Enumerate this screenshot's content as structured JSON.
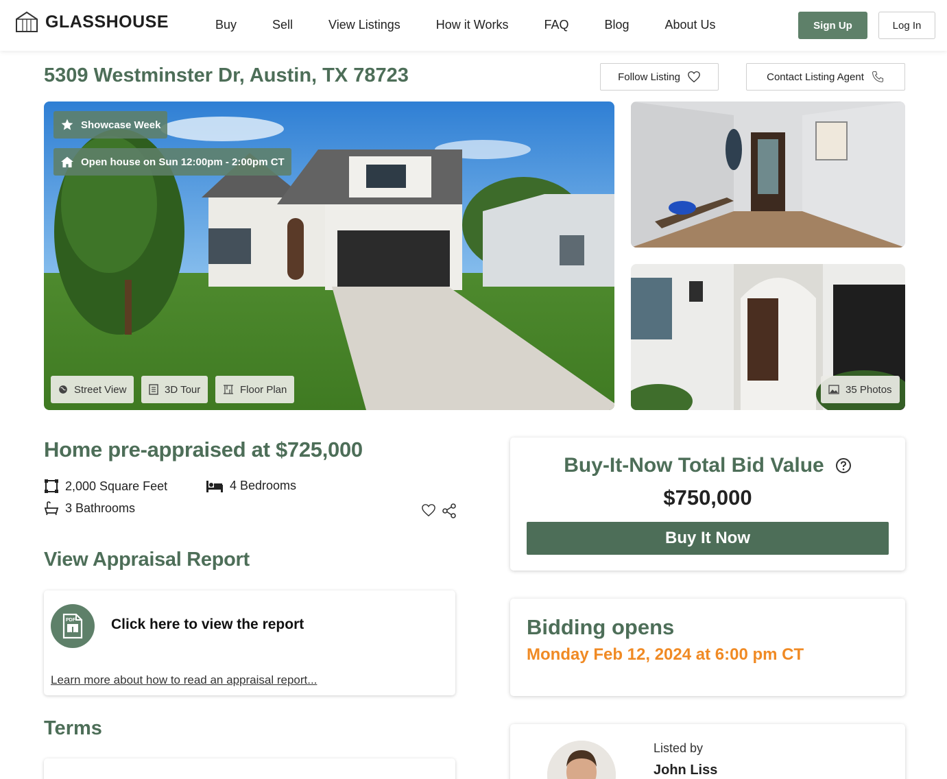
{
  "brand": {
    "name": "GLASSHOUSE",
    "accent": "#4d6e58",
    "button_green": "#5e8069",
    "orange": "#f08a24"
  },
  "nav": {
    "items": [
      {
        "label": "Buy"
      },
      {
        "label": "Sell"
      },
      {
        "label": "View Listings"
      },
      {
        "label": "How it Works"
      },
      {
        "label": "FAQ"
      },
      {
        "label": "Blog"
      },
      {
        "label": "About Us"
      }
    ],
    "signup_label": "Sign Up",
    "login_label": "Log In"
  },
  "listing": {
    "address": "5309 Westminster Dr, Austin, TX 78723",
    "follow_label": "Follow Listing",
    "contact_label": "Contact Listing Agent",
    "badges": {
      "showcase": "Showcase Week",
      "open_house": "Open house on Sun 12:00pm - 2:00pm CT"
    },
    "photo_buttons": {
      "street_view": "Street View",
      "tour_3d": "3D Tour",
      "floor_plan": "Floor Plan",
      "photos": "35 Photos"
    },
    "preappraised": "Home pre-appraised at $725,000",
    "features": {
      "sqft": "2,000 Square Feet",
      "bedrooms": "4 Bedrooms",
      "bathrooms": "3 Bathrooms"
    }
  },
  "appraisal": {
    "title": "View Appraisal Report",
    "cta": "Click here to view the report",
    "learn_more": "Learn more about how to read an appraisal report..."
  },
  "terms": {
    "title": "Terms"
  },
  "buy_it_now": {
    "title": "Buy-It-Now Total Bid Value",
    "value": "$750,000",
    "button_label": "Buy It Now"
  },
  "bidding": {
    "title": "Bidding opens",
    "date": "Monday Feb 12, 2024 at 6:00 pm CT"
  },
  "agent": {
    "listed_by_label": "Listed by",
    "name": "John Liss"
  }
}
